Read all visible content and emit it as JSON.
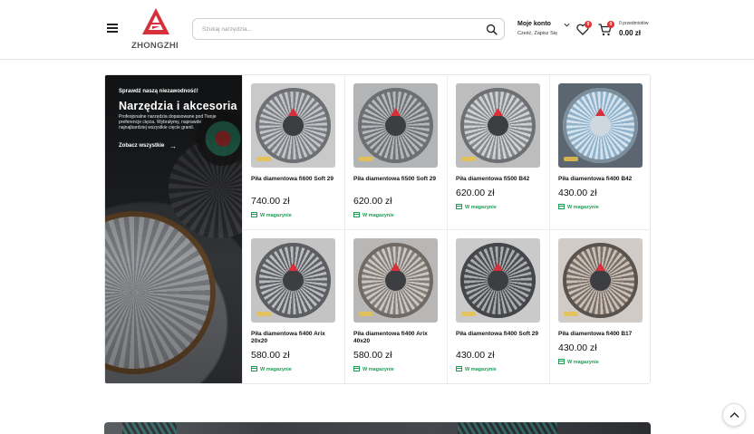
{
  "header": {
    "brand": "ZHONGZHI",
    "search_placeholder": "Szukaj narzędzia...",
    "account_title": "Moje konto",
    "account_sub": "Cześć, Zapisz Się",
    "wishlist_count": "0",
    "cart_count": "0",
    "cart_items_text": "0 przedmiotów",
    "cart_total": "0.00 zł"
  },
  "promo": {
    "kicker": "Sprawdź naszą niezawodność!",
    "title": "Narzędzia i akcesoria",
    "text": "Profesjonalne narzędzia dopasowane pod Twoje preferencje cięcia. Wybrałymy, naprawde najnajbardziej wszystkie cięcie granit.",
    "link": "Zobacz wszystkie"
  },
  "products": [
    {
      "name": "Piła diamentowa fi600 Soft 29",
      "price": "740.00 zł",
      "stock": "W magazynie"
    },
    {
      "name": "Piła diamentowa fi500 Soft 29",
      "price": "620.00 zł",
      "stock": "W magazynie"
    },
    {
      "name": "Piła diamentowa fi500 B42",
      "price": "620.00 zł",
      "stock": "W magazynie"
    },
    {
      "name": "Piła diamentowa fi400 B42",
      "price": "430.00 zł",
      "stock": "W magazynie"
    },
    {
      "name": "Piła diamentowa fi400 Arix 20x20",
      "price": "580.00 zł",
      "stock": "W magazynie"
    },
    {
      "name": "Piła diamentowa fi400 Arix 40x20",
      "price": "580.00 zł",
      "stock": "W magazynie"
    },
    {
      "name": "Piła diamentowa fi400 Soft 29",
      "price": "430.00 zł",
      "stock": "W magazynie"
    },
    {
      "name": "Piła diamentowa fi400 B17",
      "price": "430.00 zł",
      "stock": "W magazynie"
    }
  ],
  "colors": {
    "brand_red": "#e03131",
    "stock_green": "#1f9d55"
  }
}
